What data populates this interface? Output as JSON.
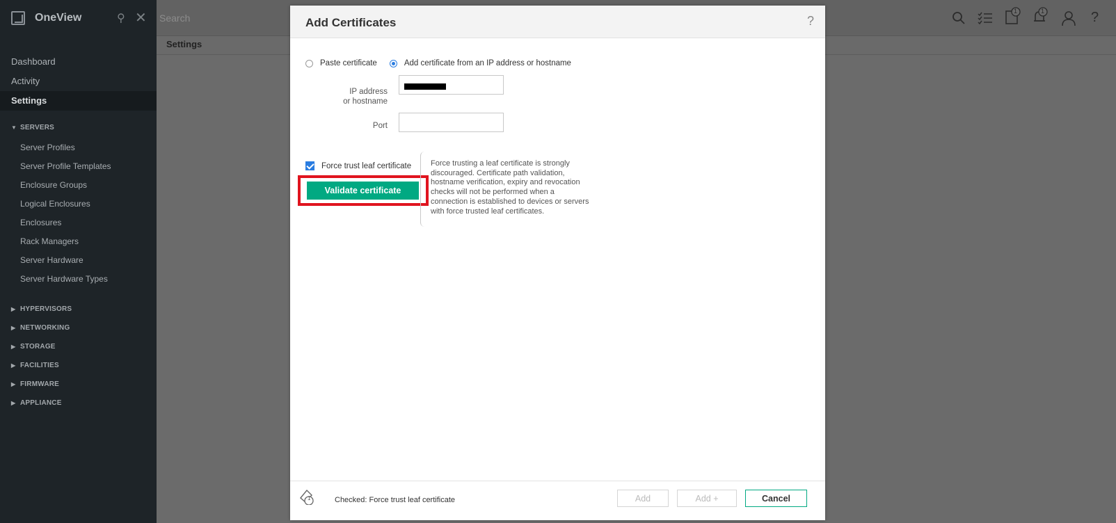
{
  "app": {
    "name": "OneView"
  },
  "topbar": {
    "search_placeholder": "Search",
    "breadcrumb": "Settings"
  },
  "sidebar": {
    "top_items": [
      "Dashboard",
      "Activity",
      "Settings"
    ],
    "active": "Settings",
    "servers_group": "SERVERS",
    "server_items": [
      "Server Profiles",
      "Server Profile Templates",
      "Enclosure Groups",
      "Logical Enclosures",
      "Enclosures",
      "Rack Managers",
      "Server Hardware",
      "Server Hardware Types"
    ],
    "collapsed_groups": [
      "HYPERVISORS",
      "NETWORKING",
      "STORAGE",
      "FACILITIES",
      "FIRMWARE",
      "APPLIANCE"
    ]
  },
  "topbar_badges": {
    "tasks": "1",
    "alerts": "1"
  },
  "dialog": {
    "title": "Add Certificates",
    "help": "?",
    "radio_paste": "Paste certificate",
    "radio_ip": "Add certificate from an IP address or hostname",
    "ip_label": "IP address or hostname",
    "ip_value": "",
    "port_label": "Port",
    "port_value": "",
    "force_trust_label": "Force trust leaf certificate",
    "validate_button": "Validate certificate",
    "note": "Force trusting a leaf certificate is strongly discouraged. Certificate path validation, hostname verification, expiry and revocation checks will not be performed when a connection is established to devices or servers with force trusted leaf certificates.",
    "footer_badge": "1",
    "footer_status": "Checked: Force trust leaf certificate",
    "btn_add": "Add",
    "btn_add_plus": "Add +",
    "btn_cancel": "Cancel"
  },
  "colors": {
    "accent": "#01a982",
    "sidebar": "#1e2428",
    "highlight": "#e0141f",
    "radio": "#2a7de1"
  }
}
